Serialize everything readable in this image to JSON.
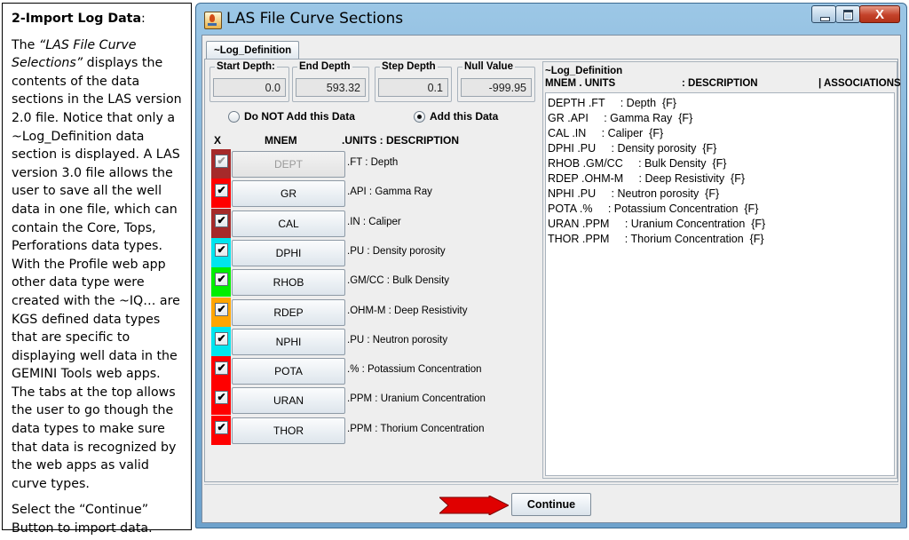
{
  "caption": {
    "title": "2-Import Log Data",
    "title_suffix": ":",
    "p1_pre": "The ",
    "p1_em": "“LAS File Curve Selections”",
    "p1_post": " displays the contents of the data sections in the LAS version 2.0 file.  Notice that only a ~Log_Definition data section is displayed.  A LAS version 3.0 file allows the user to save all the well data in one file, which can contain the Core, Tops, Perforations data types.  With the Profile web app other data type were created with the ~IQ… are KGS defined data types that are specific to displaying well data in the GEMINI Tools web apps.  The tabs at the top allows the user to go though the data types to make sure that data is recognized by the web apps as valid curve types.",
    "p2": "Select the “Continue” Button to import data."
  },
  "window": {
    "title": "LAS File Curve Sections",
    "close_glyph": "X"
  },
  "tab": {
    "label": "~Log_Definition"
  },
  "fields": {
    "start_depth": {
      "label": "Start Depth:",
      "value": "0.0"
    },
    "end_depth": {
      "label": "End Depth",
      "value": "593.32"
    },
    "step_depth": {
      "label": "Step Depth",
      "value": "0.1"
    },
    "null_value": {
      "label": "Null Value",
      "value": "-999.95"
    }
  },
  "options": {
    "not_add": {
      "label": "Do NOT Add this Data",
      "selected": false
    },
    "add": {
      "label": "Add this Data",
      "selected": true
    }
  },
  "columns": {
    "x": "X",
    "mnem": "MNEM",
    "units": ".UNITS  : DESCRIPTION"
  },
  "rows": [
    {
      "mnem": "DEPT",
      "desc": ".FT : Depth",
      "color": "#a52a2a",
      "checked": true,
      "disabled": true
    },
    {
      "mnem": "GR",
      "desc": ".API : Gamma Ray",
      "color": "#ff0000",
      "checked": true,
      "disabled": false
    },
    {
      "mnem": "CAL",
      "desc": ".IN : Caliper",
      "color": "#a52a2a",
      "checked": true,
      "disabled": false
    },
    {
      "mnem": "DPHI",
      "desc": ".PU : Density porosity",
      "color": "#00e5ee",
      "checked": true,
      "disabled": false
    },
    {
      "mnem": "RHOB",
      "desc": ".GM/CC : Bulk Density",
      "color": "#00ee00",
      "checked": true,
      "disabled": false
    },
    {
      "mnem": "RDEP",
      "desc": ".OHM-M : Deep Resistivity",
      "color": "#ffa500",
      "checked": true,
      "disabled": false
    },
    {
      "mnem": "NPHI",
      "desc": ".PU : Neutron porosity",
      "color": "#00e5ee",
      "checked": true,
      "disabled": false
    },
    {
      "mnem": "POTA",
      "desc": ".% : Potassium Concentration",
      "color": "#ff0000",
      "checked": true,
      "disabled": false
    },
    {
      "mnem": "URAN",
      "desc": ".PPM : Uranium Concentration",
      "color": "#ff0000",
      "checked": true,
      "disabled": false
    },
    {
      "mnem": "THOR",
      "desc": ".PPM : Thorium Concentration",
      "color": "#ff0000",
      "checked": true,
      "disabled": false
    }
  ],
  "right": {
    "header1": "~Log_Definition",
    "header2_mnem": "MNEM . UNITS",
    "header2_desc": ": DESCRIPTION",
    "header2_assoc": "| ASSOCIATIONS",
    "lines": [
      "DEPTH .FT     : Depth  {F}",
      "GR .API     : Gamma Ray  {F}",
      "CAL .IN     : Caliper  {F}",
      "DPHI .PU     : Density porosity  {F}",
      "RHOB .GM/CC     : Bulk Density  {F}",
      "RDEP .OHM-M     : Deep Resistivity  {F}",
      "NPHI .PU     : Neutron porosity  {F}",
      "POTA .%     : Potassium Concentration  {F}",
      "URAN .PPM     : Uranium Concentration  {F}",
      "THOR .PPM     : Thorium Concentration  {F}"
    ]
  },
  "continue_label": "Continue",
  "check_glyph": "✔"
}
